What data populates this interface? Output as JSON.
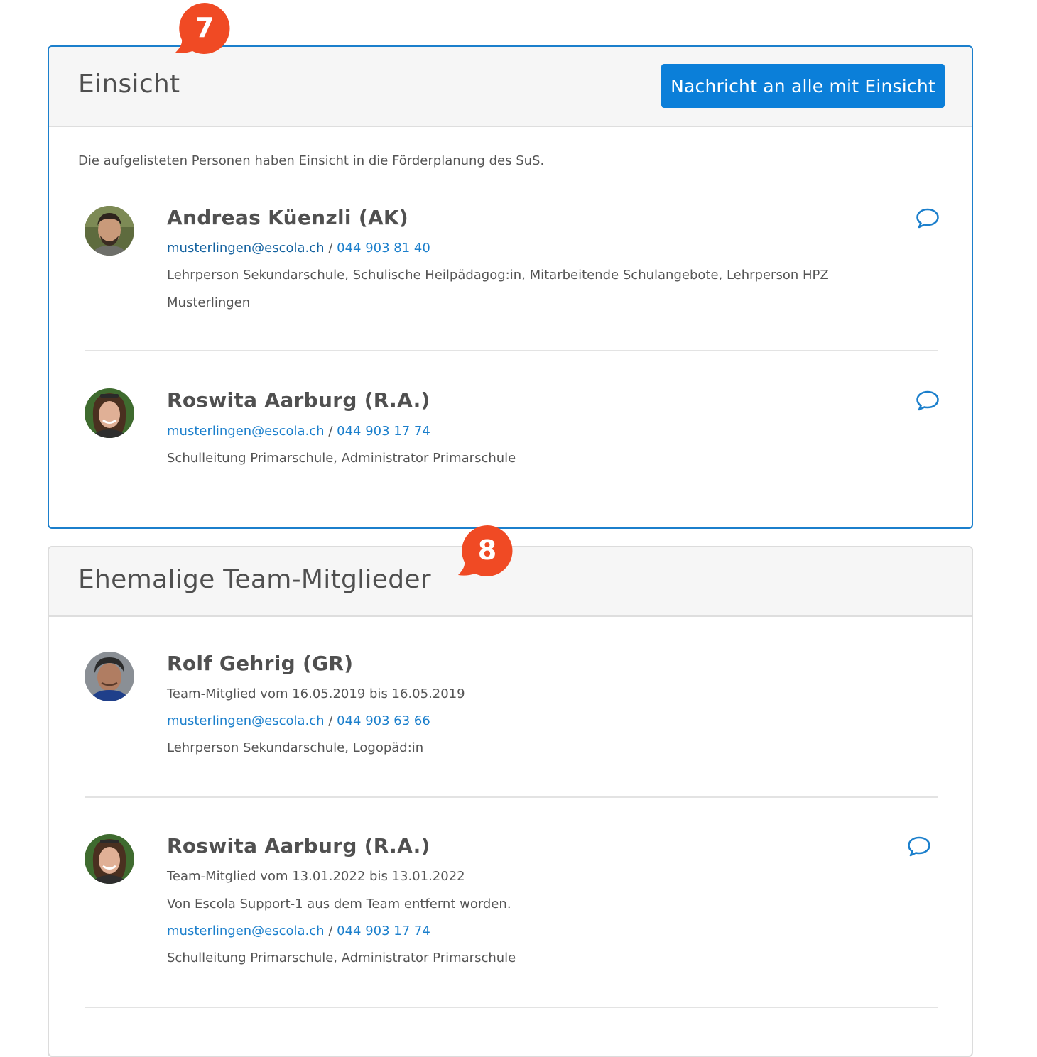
{
  "markers": {
    "einsicht": "7",
    "ehemalige": "8"
  },
  "einsicht": {
    "title": "Einsicht",
    "button_label": "Nachricht an alle mit Einsicht",
    "intro": "Die aufgelisteten Personen haben Einsicht in die Förderplanung des SuS.",
    "persons": [
      {
        "name": "Andreas Küenzli (AK)",
        "email": "musterlingen@escola.ch",
        "separator": "/",
        "phone": "044 903 81 40",
        "roles": "Lehrperson Sekundarschule, Schulische Heilpädagog:in, Mitarbeitende Schulangebote, Lehrperson HPZ Musterlingen"
      },
      {
        "name": "Roswita Aarburg (R.A.)",
        "email": "musterlingen@escola.ch",
        "separator": "/",
        "phone": "044 903 17 74",
        "roles": "Schulleitung Primarschule, Administrator Primarschule"
      }
    ]
  },
  "ehemalige": {
    "title": "Ehemalige Team-Mitglieder",
    "persons": [
      {
        "name": "Rolf Gehrig (GR)",
        "membership": "Team-Mitglied vom 16.05.2019 bis 16.05.2019",
        "email": "musterlingen@escola.ch",
        "separator": "/",
        "phone": "044 903 63 66",
        "roles": "Lehrperson Sekundarschule, Logopäd:in"
      },
      {
        "name": "Roswita Aarburg (R.A.)",
        "membership": "Team-Mitglied vom 13.01.2022 bis 13.01.2022",
        "removed_note": "Von Escola Support-1 aus dem Team entfernt worden.",
        "email": "musterlingen@escola.ch",
        "separator": "/",
        "phone": "044 903 17 74",
        "roles": "Schulleitung Primarschule, Administrator Primarschule"
      }
    ]
  },
  "colors": {
    "accent": "#0b7fd9",
    "link": "#1b7fcc",
    "marker": "#f04a24",
    "active_border": "#1b7fcc"
  },
  "icons": {
    "chat": "speech-bubble-icon",
    "marker": "annotation-marker"
  }
}
